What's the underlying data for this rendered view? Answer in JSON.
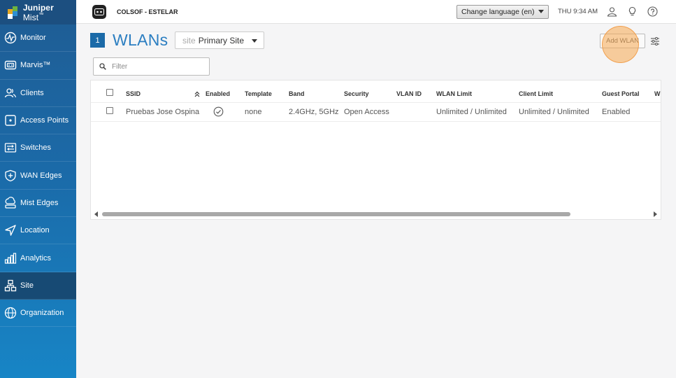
{
  "app": {
    "brand_bold": "Juniper",
    "brand_light": " Mist",
    "brand_tm": "™"
  },
  "sidebar": {
    "items": [
      {
        "label": "Monitor",
        "icon": "monitor-icon"
      },
      {
        "label": "Marvis™",
        "icon": "marvis-icon"
      },
      {
        "label": "Clients",
        "icon": "clients-icon"
      },
      {
        "label": "Access Points",
        "icon": "access-point-icon"
      },
      {
        "label": "Switches",
        "icon": "switch-icon"
      },
      {
        "label": "WAN Edges",
        "icon": "wan-edge-icon"
      },
      {
        "label": "Mist Edges",
        "icon": "mist-edge-icon"
      },
      {
        "label": "Location",
        "icon": "location-icon"
      },
      {
        "label": "Analytics",
        "icon": "analytics-icon"
      },
      {
        "label": "Site",
        "icon": "site-icon",
        "active": true
      },
      {
        "label": "Organization",
        "icon": "organization-icon"
      }
    ]
  },
  "topbar": {
    "org_name": "COLSOF - ESTELAR",
    "language_select": "Change language (en)",
    "clock": "THU 9:34 AM",
    "icons": [
      "user-icon",
      "lightbulb-icon",
      "help-icon"
    ]
  },
  "page": {
    "number": "1",
    "title": "WLANs",
    "site_prefix": "site",
    "site_value": "Primary Site",
    "add_button": "Add WLAN",
    "filter_placeholder": "Filter"
  },
  "table": {
    "columns": [
      "SSID",
      "Enabled",
      "Template",
      "Band",
      "Security",
      "VLAN ID",
      "WLAN Limit",
      "Client Limit",
      "Guest Portal",
      "WL"
    ],
    "rows": [
      {
        "ssid": "Pruebas Jose Ospina",
        "enabled": true,
        "template": "none",
        "band": "2.4GHz, 5GHz",
        "security": "Open Access",
        "vlan_id": "",
        "wlan_limit": "Unlimited / Unlimited",
        "client_limit": "Unlimited / Unlimited",
        "guest_portal": "Enabled"
      }
    ]
  },
  "colors": {
    "sidebar_top": "#1f5c93",
    "sidebar_bottom": "#1785c6",
    "accent": "#2b7ec1",
    "highlight": "#f6a850"
  }
}
